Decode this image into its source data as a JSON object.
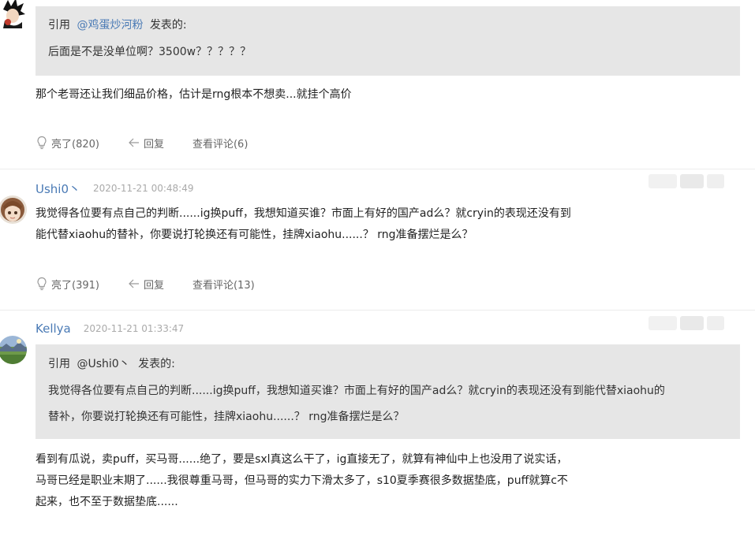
{
  "posts": [
    {
      "quote": {
        "prefix": "引用",
        "user": "@鸡蛋炒河粉",
        "suffix": "发表的:",
        "text": "后面是不是没单位啊？3500w？？？？？"
      },
      "body": "那个老哥还让我们细品价格，估计是rng根本不想卖...就挂个高价",
      "actions": {
        "likes": "亮了(820)",
        "reply": "回复",
        "comments": "查看评论(6)"
      }
    },
    {
      "username": "Ushi0丶",
      "date": "2020-11-21 00:48:49",
      "body_lines": [
        "我觉得各位要有点自己的判断......ig换puff，我想知道买谁？市面上有好的国产ad么？就cryin的表现还没有到",
        "能代替xiaohu的替补，你要说打轮换还有可能性，挂牌xiaohu......？ rng准备摆烂是么？"
      ],
      "actions": {
        "likes": "亮了(391)",
        "reply": "回复",
        "comments": "查看评论(13)"
      }
    },
    {
      "username": "Kellya",
      "date": "2020-11-21 01:33:47",
      "quote": {
        "prefix": "引用",
        "user": "@Ushi0丶",
        "suffix": "发表的:",
        "text_lines": [
          "我觉得各位要有点自己的判断......ig换puff，我想知道买谁？市面上有好的国产ad么？就cryin的表现还没有到能代替xiaohu的",
          "替补，你要说打轮换还有可能性，挂牌xiaohu......？ rng准备摆烂是么？"
        ]
      },
      "body_lines": [
        "看到有瓜说，卖puff，买马哥......绝了，要是sxl真这么干了，ig直接无了，就算有神仙中上也没用了说实话，",
        "马哥已经是职业末期了......我很尊重马哥，但马哥的实力下滑太多了，s10夏季赛很多数据垫底，puff就算c不",
        "起来，也不至于数据垫底......"
      ]
    }
  ],
  "icons": {
    "like": "lightbulb-icon",
    "reply": "reply-arrow-icon"
  },
  "colors": {
    "username": "#4a7ab5",
    "quote_bg": "#e6e6e6",
    "meta": "#aaaaaa"
  }
}
